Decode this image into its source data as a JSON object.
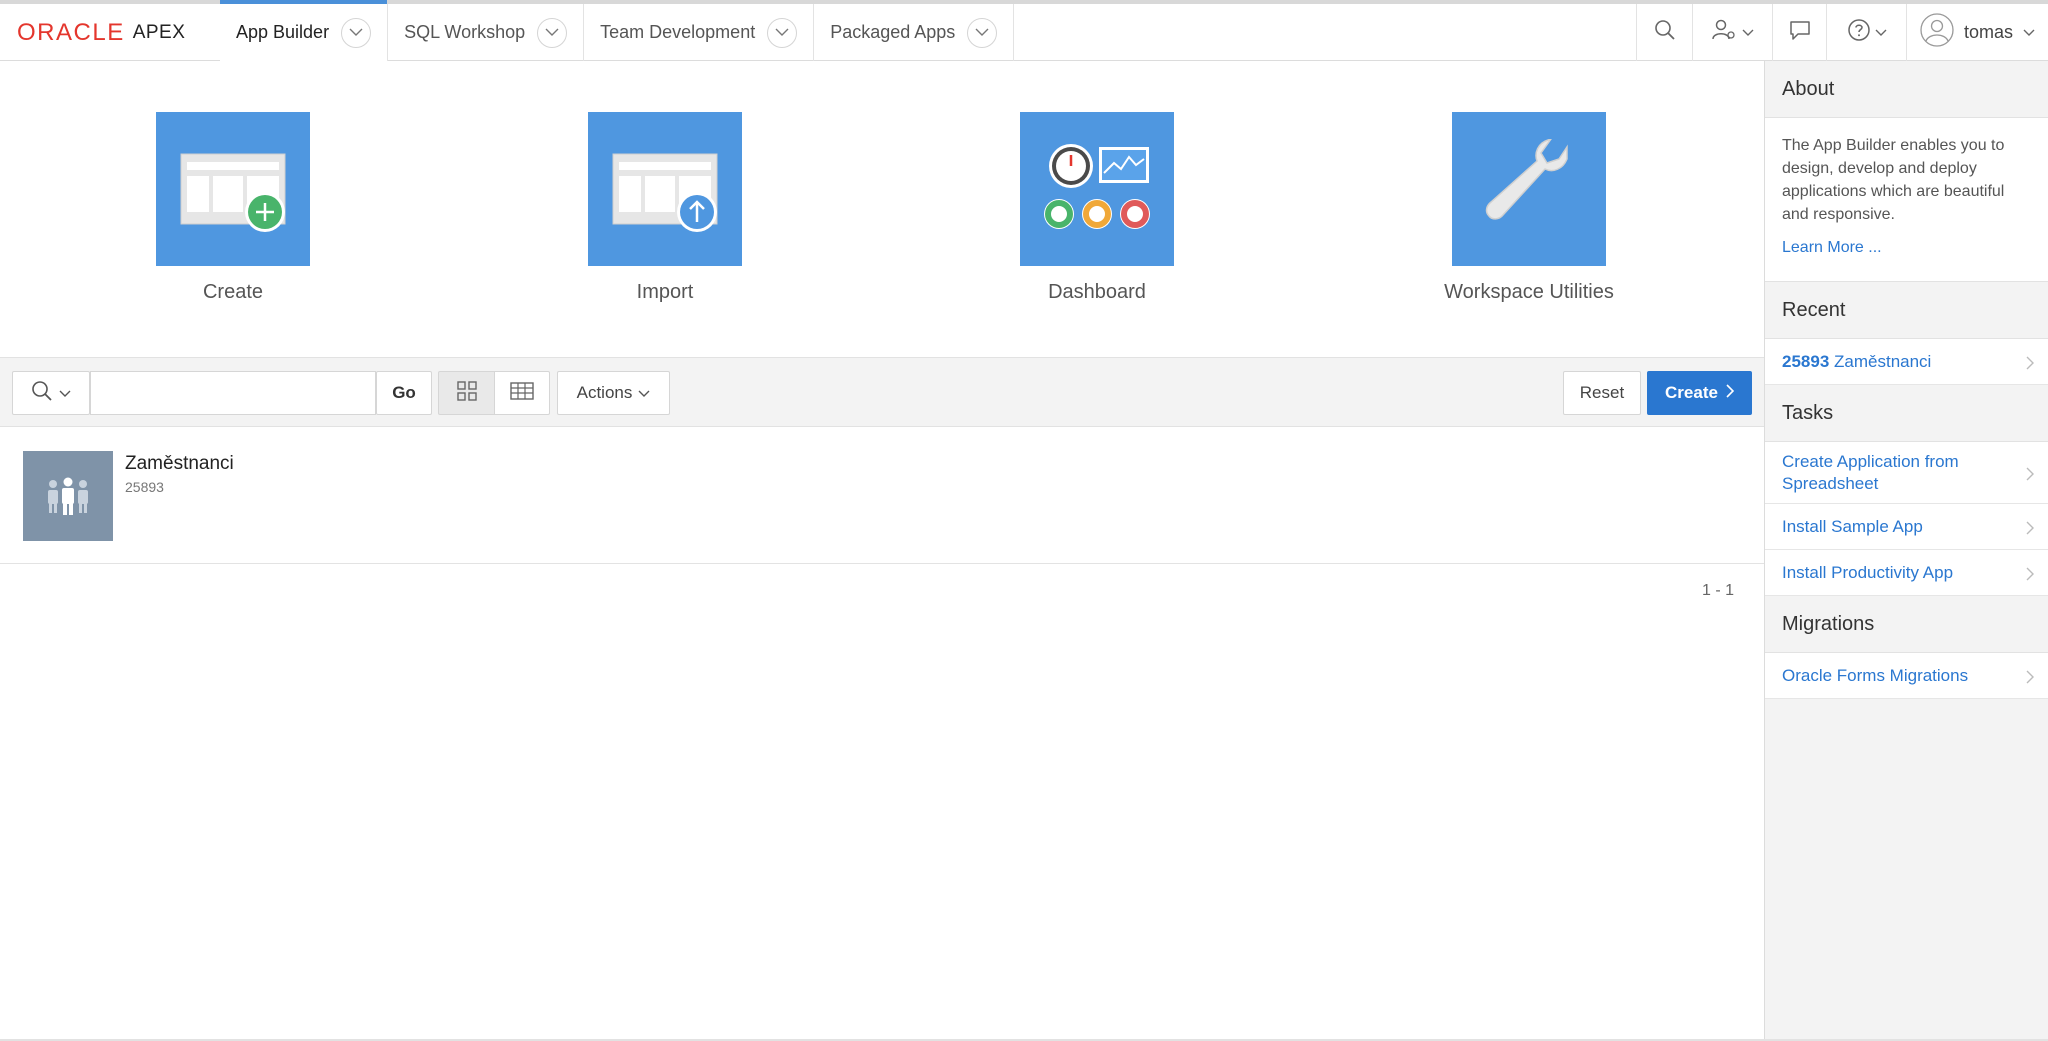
{
  "brand": {
    "oracle": "ORACLE",
    "apex": "APEX"
  },
  "nav": {
    "tabs": [
      {
        "label": "App Builder",
        "active": true
      },
      {
        "label": "SQL Workshop"
      },
      {
        "label": "Team Development"
      },
      {
        "label": "Packaged Apps"
      }
    ],
    "user": "tomas"
  },
  "tiles": [
    {
      "label": "Create",
      "icon": "create-app-icon"
    },
    {
      "label": "Import",
      "icon": "import-app-icon"
    },
    {
      "label": "Dashboard",
      "icon": "dashboard-icon"
    },
    {
      "label": "Workspace Utilities",
      "icon": "wrench-icon"
    }
  ],
  "toolbar": {
    "search_value": "",
    "go": "Go",
    "actions": "Actions",
    "reset": "Reset",
    "create": "Create"
  },
  "apps": [
    {
      "name": "Zaměstnanci",
      "id": "25893"
    }
  ],
  "pagination": "1 - 1",
  "side": {
    "about_title": "About",
    "about_text": "The App Builder enables you to design, develop and deploy applications which are beautiful and responsive.",
    "learn_more": "Learn More ...",
    "recent_title": "Recent",
    "recent": [
      {
        "id": "25893",
        "name": "Zaměstnanci"
      }
    ],
    "tasks_title": "Tasks",
    "tasks": [
      "Create Application from Spreadsheet",
      "Install Sample App",
      "Install Productivity App"
    ],
    "migrations_title": "Migrations",
    "migrations": [
      "Oracle Forms Migrations"
    ]
  },
  "colors": {
    "accent": "#2a77d0",
    "tile": "#4f97e0",
    "brand_red": "#e4362d"
  }
}
